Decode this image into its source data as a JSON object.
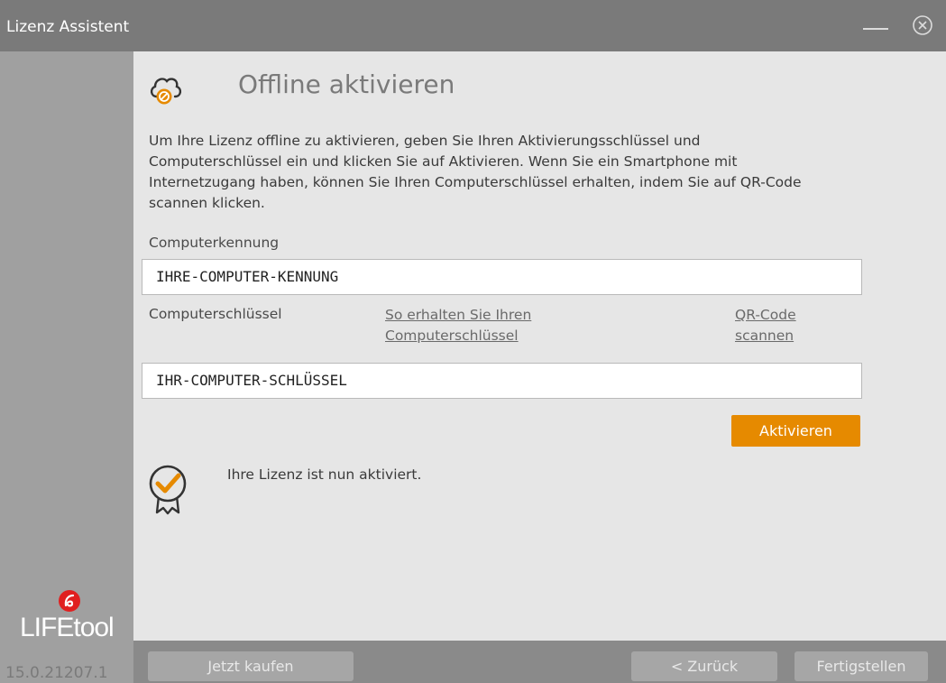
{
  "window": {
    "title": "Lizenz Assistent",
    "minimize_icon": "minimize-icon",
    "close_icon": "close-circle-icon"
  },
  "sidebar": {
    "logo_text": "LIFEtool",
    "version": "15.0.21207.1"
  },
  "main": {
    "title": "Offline aktivieren",
    "header_icon": "cloud-blocked-icon",
    "description": "Um Ihre Lizenz offline zu aktivieren, geben Sie Ihren Aktivierungsschlüssel und Computerschlüssel ein und klicken Sie auf Aktivieren. Wenn Sie ein Smartphone mit Internetzugang haben, können Sie Ihren Computerschlüssel erhalten, indem Sie auf QR-Code scannen klicken.",
    "computer_id_label": "Computerkennung",
    "computer_id_value": "IHRE-COMPUTER-KENNUNG",
    "computer_key_label": "Computerschlüssel",
    "how_to_link_line1": "So erhalten Sie Ihren",
    "how_to_link_line2": "Computerschlüssel",
    "qr_link_line1": "QR-Code",
    "qr_link_line2": "scannen",
    "computer_key_value": "IHR-COMPUTER-SCHLÜSSEL",
    "activate_label": "Aktivieren",
    "status_icon": "badge-check-icon",
    "status_text": "Ihre Lizenz ist nun aktiviert."
  },
  "footer": {
    "buy_label": "Jetzt kaufen",
    "back_label": "< Zurück",
    "finish_label": "Fertigstellen"
  },
  "colors": {
    "accent": "#e68a00",
    "titlebar": "#7a7a7a",
    "sidebar": "#a0a0a0",
    "background": "#e6e6e6",
    "footer": "#8a8a8a"
  }
}
